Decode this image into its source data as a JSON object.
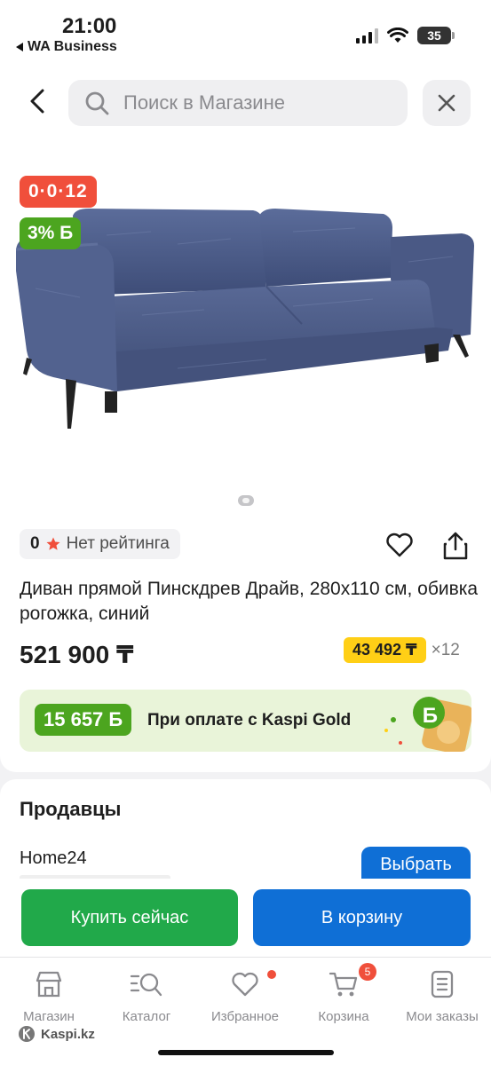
{
  "status_bar": {
    "time": "21:00",
    "back_app": "WA Business",
    "battery": "35"
  },
  "header": {
    "search_placeholder": "Поиск в Магазине"
  },
  "product": {
    "promo_badge": "0·0·12",
    "bonus_badge": "3% Б",
    "rating_value": "0",
    "rating_text": "Нет рейтинга",
    "title": "Диван прямой Пинскдрев Драйв, 280x110 см, обивка рогожка, синий",
    "price": "521 900 ₸",
    "installment_amount": "43 492 ₸",
    "installment_months": "×12",
    "gold_bonus": "15 657 Б",
    "gold_text": "При оплате с Kaspi Gold",
    "gold_deco_letter": "Б"
  },
  "sellers": {
    "heading": "Продавцы",
    "items": [
      {
        "name": "Home24",
        "button": "Выбрать"
      }
    ]
  },
  "actions": {
    "buy_now": "Купить сейчас",
    "add_to_cart": "В корзину"
  },
  "tabbar": {
    "items": [
      {
        "label": "Магазин",
        "icon": "store-icon"
      },
      {
        "label": "Каталог",
        "icon": "catalog-search-icon"
      },
      {
        "label": "Избранное",
        "icon": "heart-icon"
      },
      {
        "label": "Корзина",
        "icon": "cart-icon",
        "badge": "5"
      },
      {
        "label": "Мои заказы",
        "icon": "orders-icon"
      }
    ],
    "brand": "Kaspi.kz"
  },
  "colors": {
    "green": "#21a94a",
    "blue": "#0f6fd6",
    "red": "#f04f3b",
    "yellow": "#ffcf16",
    "bonus_green": "#4ca51f"
  }
}
